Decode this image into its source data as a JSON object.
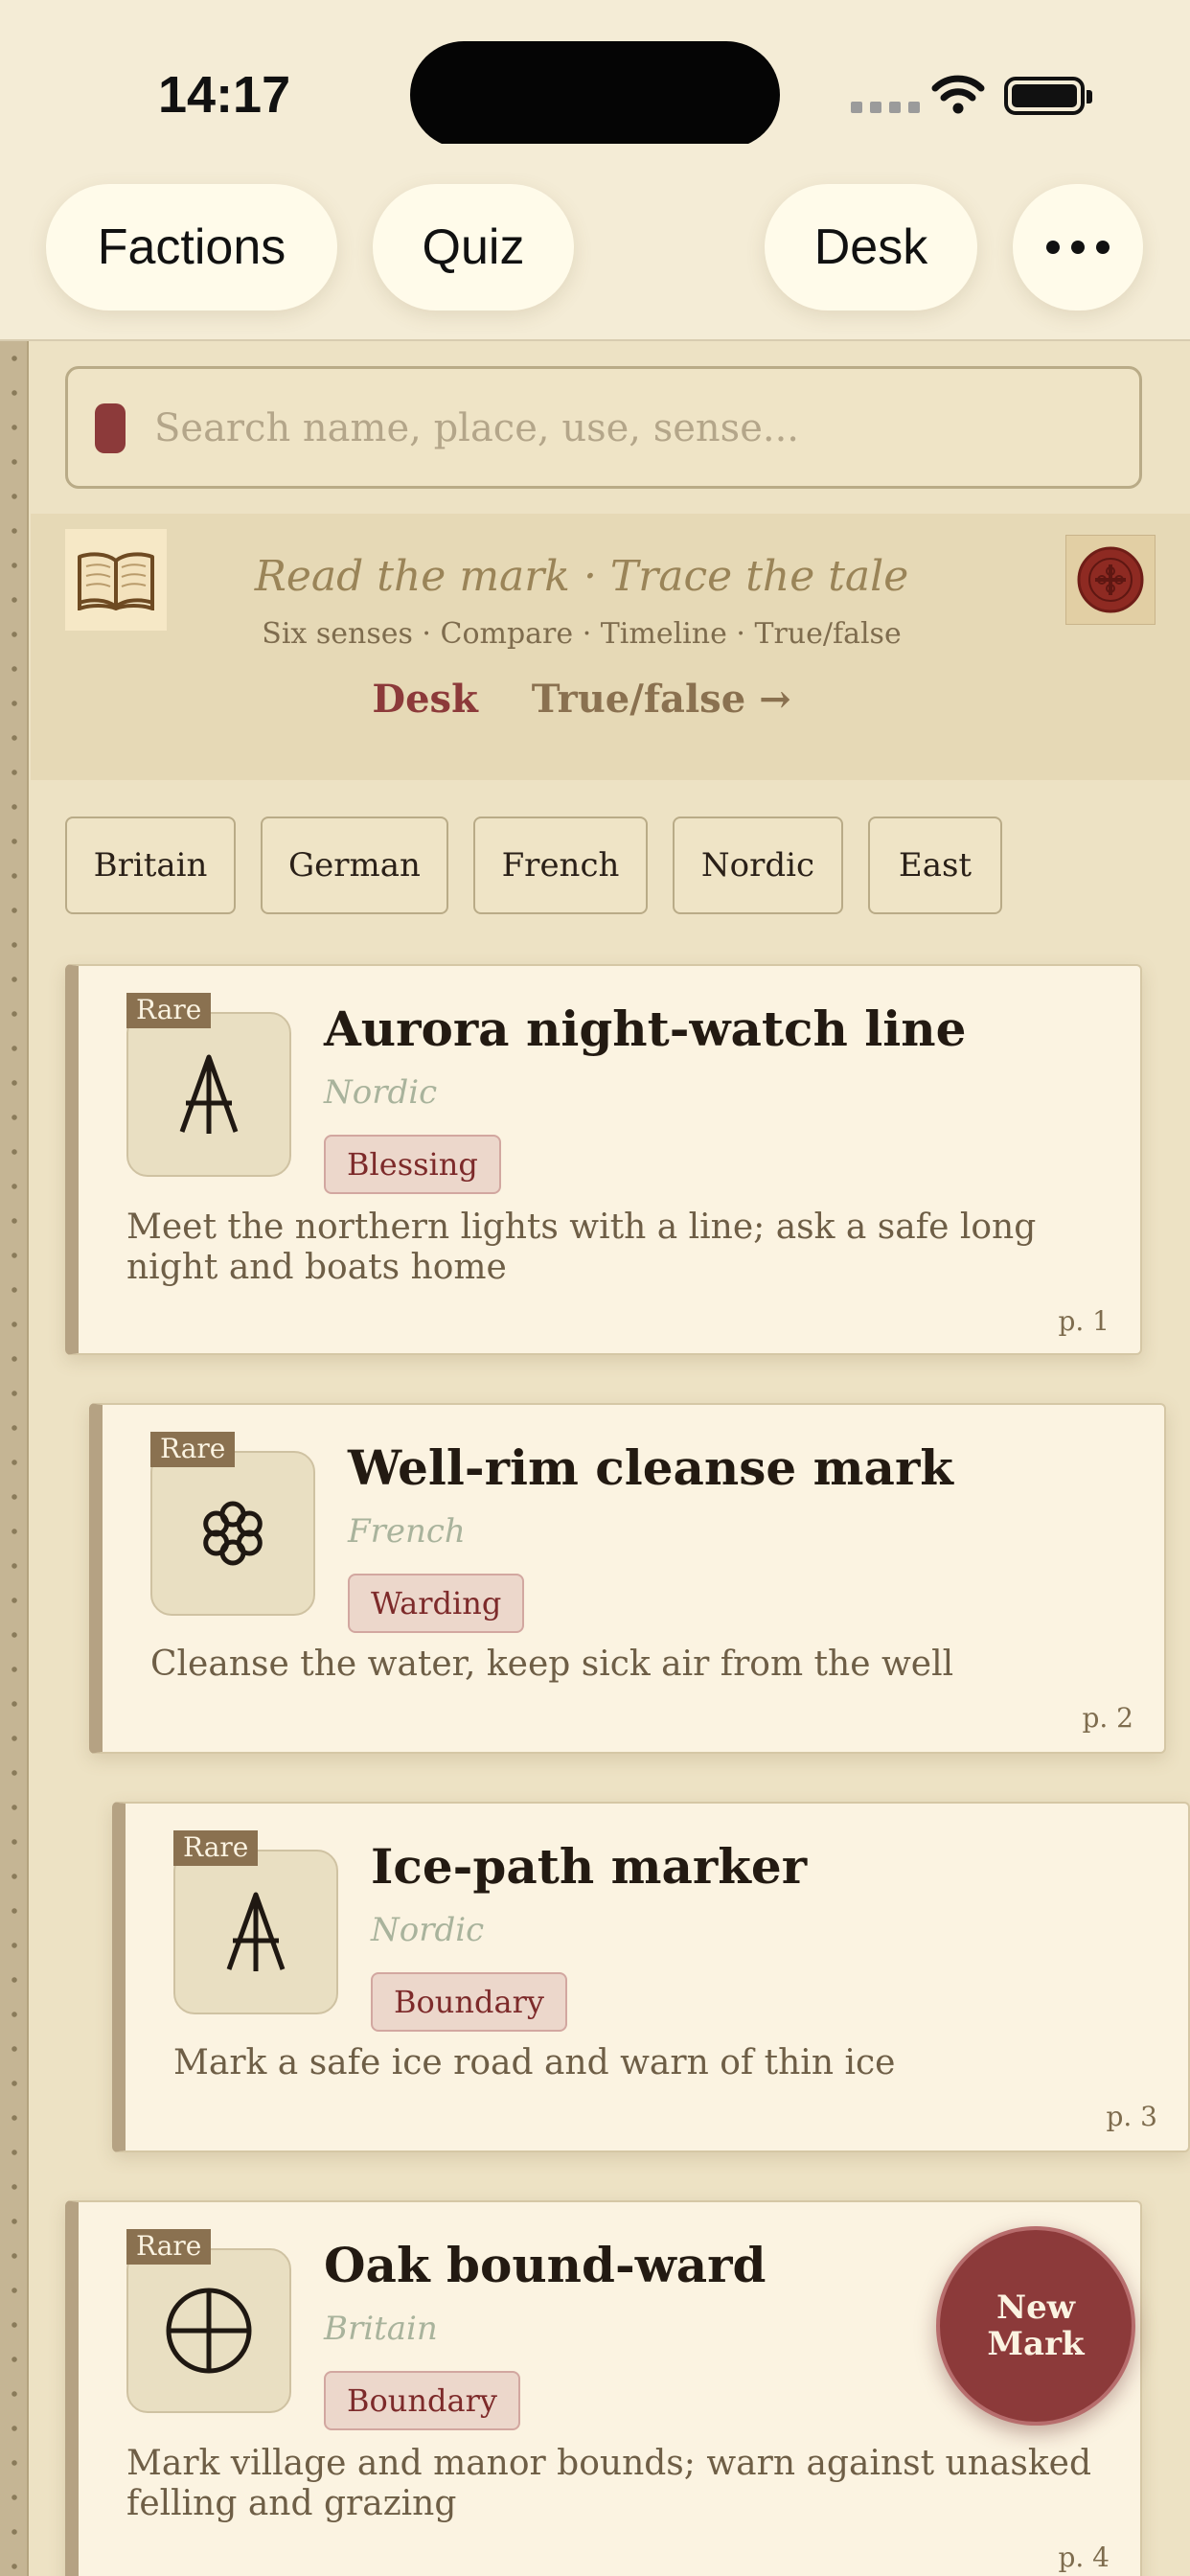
{
  "status_bar": {
    "time": "14:17"
  },
  "nav": {
    "factions_label": "Factions",
    "quiz_label": "Quiz",
    "desk_label": "Desk"
  },
  "search": {
    "placeholder": "Search name, place, use, sense..."
  },
  "banner": {
    "tagline": "Read the mark · Trace the tale",
    "subline": "Six senses · Compare · Timeline · True/false",
    "link_desk": "Desk",
    "link_truefalse": "True/false →"
  },
  "filters": [
    "Britain",
    "German",
    "French",
    "Nordic",
    "East"
  ],
  "cards": [
    {
      "badge": "Rare",
      "icon": "arrow-rune-icon",
      "title": "Aurora night-watch line",
      "region": "Nordic",
      "tag": "Blessing",
      "desc": "Meet the northern lights with a line; ask a safe long night and boats home",
      "page": "p. 1"
    },
    {
      "badge": "Rare",
      "icon": "flower-rosette-icon",
      "title": "Well-rim cleanse mark",
      "region": "French",
      "tag": "Warding",
      "desc": "Cleanse the water, keep sick air from the well",
      "page": "p. 2"
    },
    {
      "badge": "Rare",
      "icon": "arrow-rune-icon",
      "title": "Ice-path marker",
      "region": "Nordic",
      "tag": "Boundary",
      "desc": "Mark a safe ice road and warn of thin ice",
      "page": "p. 3"
    },
    {
      "badge": "Rare",
      "icon": "circled-cross-icon",
      "title": "Oak bound-ward",
      "region": "Britain",
      "tag": "Boundary",
      "desc": "Mark village and manor bounds; warn against unasked felling and grazing",
      "page": "p. 4"
    }
  ],
  "fab": {
    "line1": "New",
    "line2": "Mark"
  },
  "colors": {
    "accent": "#8c3a3a",
    "parchment": "#fbf3e1",
    "background": "#ede2c4"
  }
}
